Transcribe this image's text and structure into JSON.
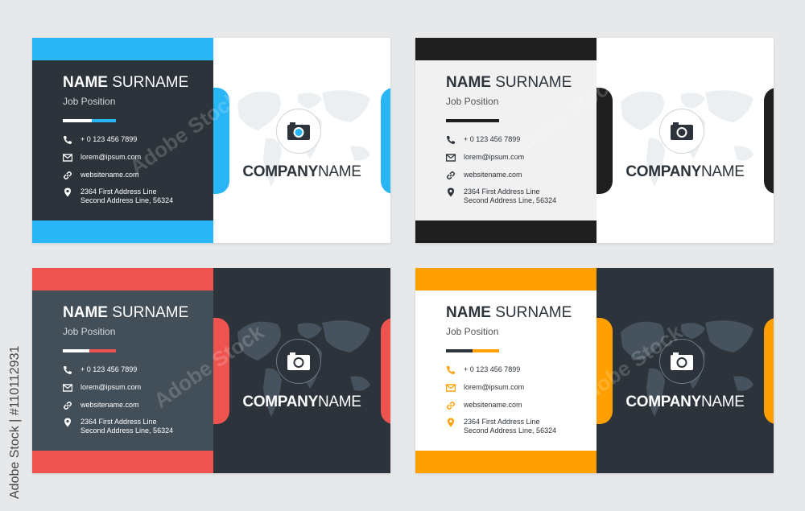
{
  "cards": [
    {
      "name_bold": "NAME",
      "name_rest": " SURNAME",
      "job": "Job Position",
      "phone": "+ 0 123 456 7899",
      "email": "lorem@ipsum.com",
      "web": "websitename.com",
      "addr1": "2364 First Address Line",
      "addr2": "Second Address Line, 56324",
      "company_bold": "COMPANY",
      "company_rest": "NAME",
      "accent": "#29b6f6",
      "info_bg": "#2c333b",
      "text": "#ffffff",
      "right_bg": "#ffffff"
    },
    {
      "name_bold": "NAME",
      "name_rest": " SURNAME",
      "job": "Job Position",
      "phone": "+ 0 123 456 7899",
      "email": "lorem@ipsum.com",
      "web": "websitename.com",
      "addr1": "2364 First Address Line",
      "addr2": "Second Address Line, 56324",
      "company_bold": "COMPANY",
      "company_rest": "NAME",
      "accent": "#1f1f1f",
      "info_bg": "#f1f1f1",
      "text": "#2c333b",
      "right_bg": "#ffffff"
    },
    {
      "name_bold": "NAME",
      "name_rest": " SURNAME",
      "job": "Job Position",
      "phone": "+ 0 123 456 7899",
      "email": "lorem@ipsum.com",
      "web": "websitename.com",
      "addr1": "2364 First Address Line",
      "addr2": "Second Address Line, 56324",
      "company_bold": "COMPANY",
      "company_rest": "NAME",
      "accent": "#ef5350",
      "info_bg": "#424e58",
      "text": "#ffffff",
      "right_bg": "#2c333b"
    },
    {
      "name_bold": "NAME",
      "name_rest": " SURNAME",
      "job": "Job Position",
      "phone": "+ 0 123 456 7899",
      "email": "lorem@ipsum.com",
      "web": "websitename.com",
      "addr1": "2364 First Address Line",
      "addr2": "Second Address Line, 56324",
      "company_bold": "COMPANY",
      "company_rest": "NAME",
      "accent": "#ffa000",
      "info_bg": "#ffffff",
      "text": "#2c333b",
      "right_bg": "#2c333b"
    }
  ],
  "side_id": "Adobe Stock | #110112931",
  "watermark": "Adobe Stock"
}
